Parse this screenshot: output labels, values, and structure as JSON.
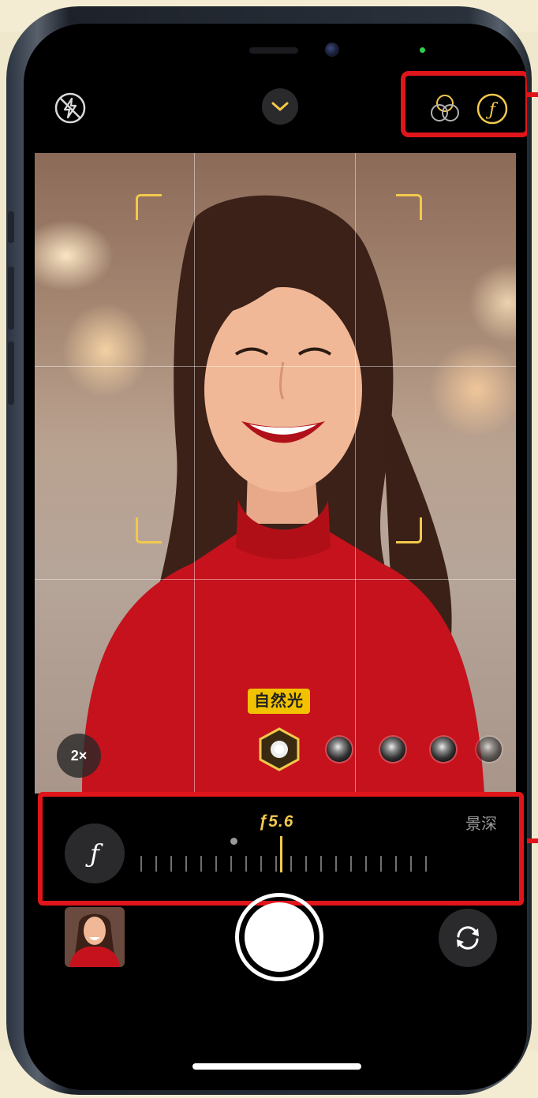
{
  "top_bar": {
    "flash_icon": "flash-off-icon",
    "expand_icon": "chevron-down-icon",
    "filters_icon": "filters-icon",
    "aperture_icon": "aperture-f-icon"
  },
  "viewfinder": {
    "lighting_label": "自然光",
    "zoom_label": "2×",
    "lighting_effects": [
      "natural-light",
      "studio-light",
      "contour-light",
      "stage-light",
      "stage-light-mono"
    ]
  },
  "depth_control": {
    "f_symbol": "ƒ",
    "f_value": "ƒ5.6",
    "label": "景深"
  },
  "bottom_bar": {
    "thumbnail": "last-photo-thumbnail",
    "shutter": "shutter-button",
    "flip_icon": "camera-flip-icon"
  },
  "annotations": {
    "highlight_color": "#e0151b",
    "accent_color": "#f2c94c"
  }
}
